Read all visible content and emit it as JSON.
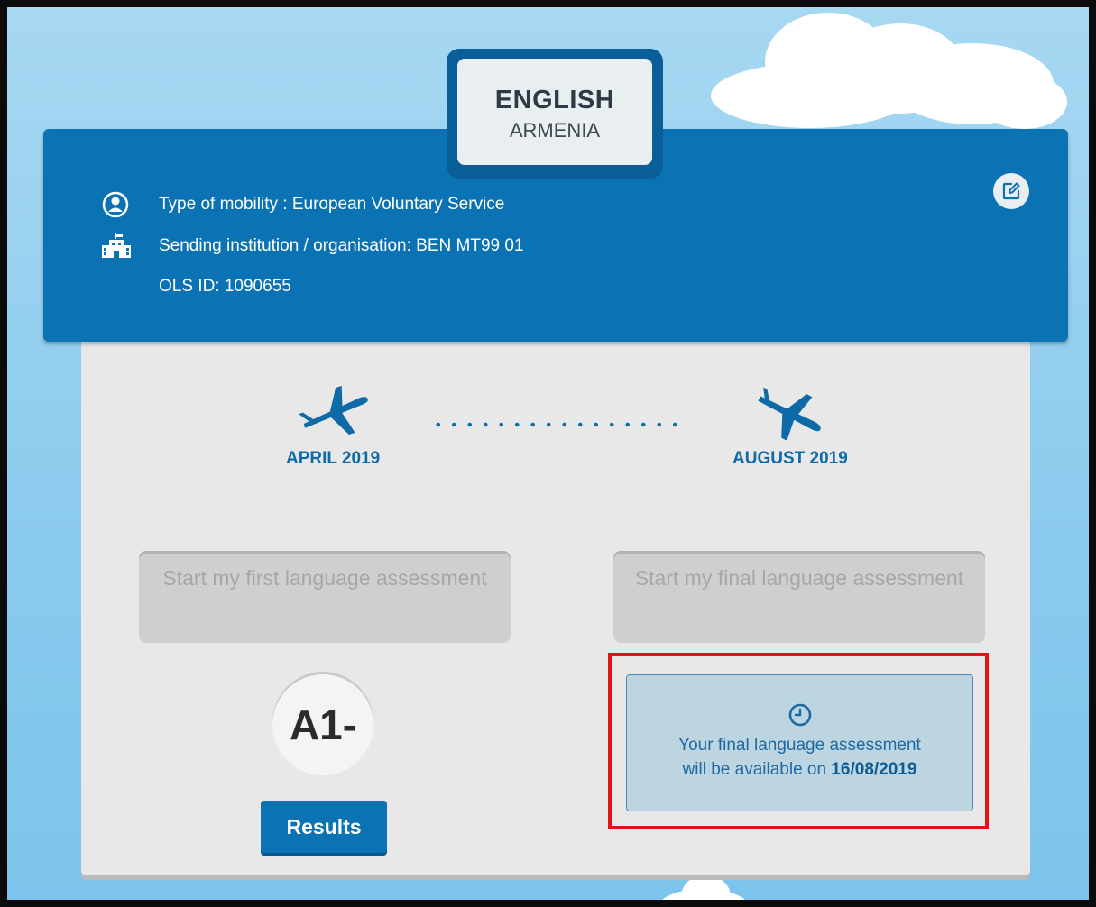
{
  "language": {
    "name": "ENGLISH",
    "country": "ARMENIA"
  },
  "details": {
    "mobility": "Type of mobility : European Voluntary Service",
    "institution": "Sending institution / organisation: BEN MT99 01",
    "ols_id": "OLS ID: 1090655"
  },
  "icons": {
    "user": "user-circle-icon",
    "institution": "institution-building-icon",
    "edit": "edit-icon",
    "depart": "plane-takeoff-icon",
    "arrive": "plane-landing-icon",
    "clock": "clock-icon"
  },
  "timeline": {
    "start_date": "APRIL 2019",
    "end_date": "AUGUST 2019"
  },
  "first_assessment": {
    "button_label": "Start my first language assessment",
    "level": "A1-",
    "results_label": "Results"
  },
  "final_assessment": {
    "button_label": "Start my final language assessment",
    "notice_text": "Your final language assessment will be available on",
    "notice_date": "16/08/2019"
  },
  "colors": {
    "primary_blue": "#0b73b4",
    "dark_blue": "#0b5f98",
    "sky": "#8ccbee",
    "highlight_red": "#e01515"
  }
}
